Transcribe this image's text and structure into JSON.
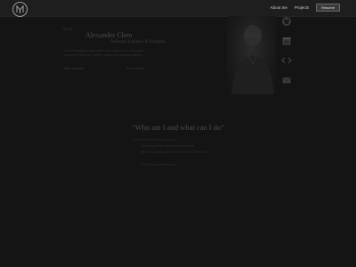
{
  "nav": {
    "links": [
      "About me",
      "Projects"
    ],
    "button_label": "Resume"
  },
  "hero": {
    "kicker": "Hi, I'm",
    "name": "Alexander Chen",
    "role": "Software Engineer & Designer",
    "line1": "I build thoughtful, accessible web experiences and tools.",
    "line2": "Currently exploring creative coding and design systems.",
    "link1": "View my work",
    "link2": "Get in touch"
  },
  "social": [
    "github-icon",
    "calendar-icon",
    "code-icon",
    "mail-icon"
  ],
  "about": {
    "heading": "“Who am I and what can I do”",
    "sub1": "A short introduction about me",
    "sub2": "My background, skills and experience.",
    "sub3": "What I'm passionate about and what drives me.",
    "sub4": "Scroll down to learn more."
  },
  "colors": {
    "background": "#141414",
    "topbar": "#1e1e1e",
    "accent": "#9a9a9a"
  }
}
